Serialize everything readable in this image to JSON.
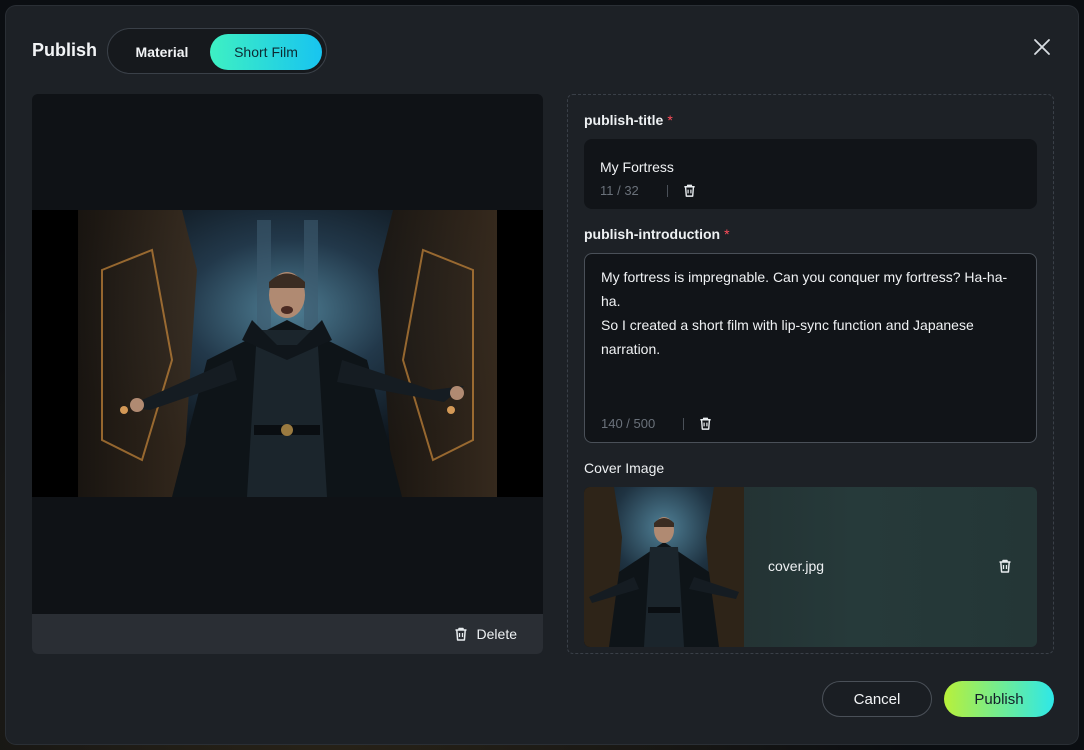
{
  "dialog": {
    "title": "Publish",
    "tabs": [
      {
        "label": "Material",
        "active": false
      },
      {
        "label": "Short Film",
        "active": true
      }
    ],
    "close_icon": "close-icon"
  },
  "preview": {
    "image_alt": "Caped man with outstretched arms in a mechanical corridor",
    "delete_label": "Delete",
    "delete_icon": "trash-icon"
  },
  "form": {
    "title_label": "publish-title",
    "title_required": "*",
    "title_value": "My Fortress",
    "title_counter": "11 / 32",
    "intro_label": "publish-introduction",
    "intro_required": "*",
    "intro_value": "My fortress is impregnable. Can you conquer my fortress? Ha-ha-\nha.\nSo I created a short film with lip-sync function and Japanese\nnarration.",
    "intro_counter": "140 / 500",
    "cover_label": "Cover Image",
    "cover_filename": "cover.jpg"
  },
  "footer": {
    "cancel_label": "Cancel",
    "publish_label": "Publish"
  },
  "colors": {
    "accent_gradient_start": "#3ef0c3",
    "accent_gradient_end": "#18c4f0",
    "publish_gradient_start": "#b8f03a",
    "publish_gradient_end": "#2ee8e8",
    "required": "#ff4d5a",
    "modal_bg": "#1d2126"
  }
}
